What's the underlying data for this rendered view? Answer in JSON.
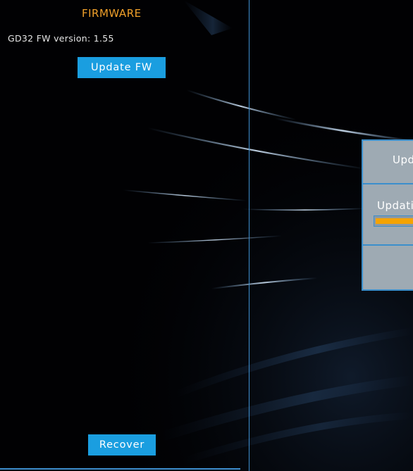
{
  "firmware": {
    "section_title": "FIRMWARE",
    "version_text": "GD32 FW version: 1.55",
    "update_button_label": "Update FW",
    "recover_button_label": "Recover"
  },
  "dialog": {
    "title": "Update",
    "status_text": "Updating",
    "progress": 0.6
  },
  "colors": {
    "accent_orange": "#f0a02a",
    "button_blue": "#1a9ee0",
    "border_blue": "#3e8fd0",
    "dialog_bg": "#9eaab3",
    "progress_fill": "#f5a300"
  }
}
